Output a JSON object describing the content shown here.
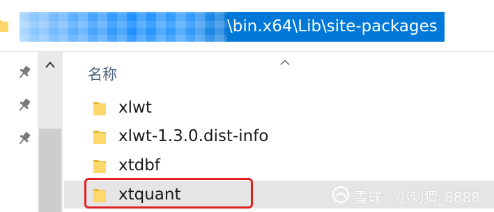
{
  "address_bar": {
    "path_text": "\\bin.x64\\Lib\\site-packages"
  },
  "file_list": {
    "column_header": "名称",
    "items": [
      {
        "name": "xlwt"
      },
      {
        "name": "xlwt-1.3.0.dist-info"
      },
      {
        "name": "xtdbf"
      },
      {
        "name": "xtquant"
      }
    ]
  },
  "watermark": {
    "text": "雪球：小刺猬_8888"
  },
  "colors": {
    "selection_blue": "#0078d7",
    "folder_yellow": "#f7c948",
    "highlight_red": "#e02020"
  },
  "icons": [
    "folder-icon",
    "pin-icon",
    "chevron-up-icon",
    "sort-up-icon",
    "snowball-logo-icon"
  ]
}
